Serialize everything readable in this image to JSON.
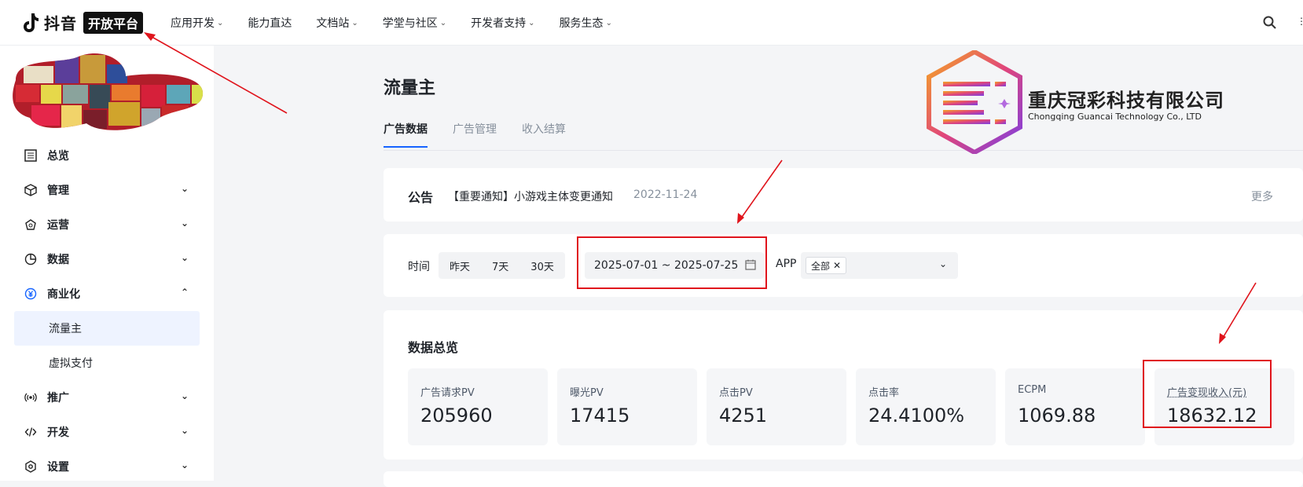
{
  "topnav": {
    "brand": "抖音",
    "platform": "开放平台",
    "items": [
      {
        "label": "应用开发",
        "has_menu": true
      },
      {
        "label": "能力直达",
        "has_menu": false
      },
      {
        "label": "文档站",
        "has_menu": true
      },
      {
        "label": "学堂与社区",
        "has_menu": true
      },
      {
        "label": "开发者支持",
        "has_menu": true
      },
      {
        "label": "服务生态",
        "has_menu": true
      }
    ]
  },
  "sidebar": {
    "items": [
      {
        "label": "总览",
        "icon": "overview-icon"
      },
      {
        "label": "管理",
        "icon": "cube-icon"
      },
      {
        "label": "运营",
        "icon": "operate-icon"
      },
      {
        "label": "数据",
        "icon": "pie-chart-icon"
      },
      {
        "label": "商业化",
        "icon": "yen-icon"
      },
      {
        "label": "流量主"
      },
      {
        "label": "虚拟支付"
      },
      {
        "label": "推广",
        "icon": "broadcast-icon"
      },
      {
        "label": "开发",
        "icon": "code-icon"
      },
      {
        "label": "设置",
        "icon": "settings-icon"
      }
    ]
  },
  "page": {
    "title": "流量主",
    "tabs": [
      "广告数据",
      "广告管理",
      "收入结算"
    ]
  },
  "notice": {
    "label": "公告",
    "text": "【重要通知】小游戏主体变更通知",
    "date": "2022-11-24",
    "more": "更多"
  },
  "filters": {
    "time_label": "时间",
    "quick_ranges": [
      "昨天",
      "7天",
      "30天"
    ],
    "date_range": "2025-07-01 ~ 2025-07-25",
    "app_label": "APP",
    "app_tag": "全部"
  },
  "overview": {
    "title": "数据总览",
    "metrics": [
      {
        "label": "广告请求PV",
        "value": "205960"
      },
      {
        "label": "曝光PV",
        "value": "17415"
      },
      {
        "label": "点击PV",
        "value": "4251"
      },
      {
        "label": "点击率",
        "value": "24.4100%"
      },
      {
        "label": "ECPM",
        "value": "1069.88"
      },
      {
        "label": "广告变现收入(元)",
        "value": "18632.12"
      }
    ]
  },
  "watermark": {
    "name_cn": "重庆冠彩科技有限公司",
    "name_en": "Chongqing Guancai Technology Co., LTD"
  },
  "colors": {
    "accent": "#1664ff",
    "annotation": "#e0141c"
  }
}
